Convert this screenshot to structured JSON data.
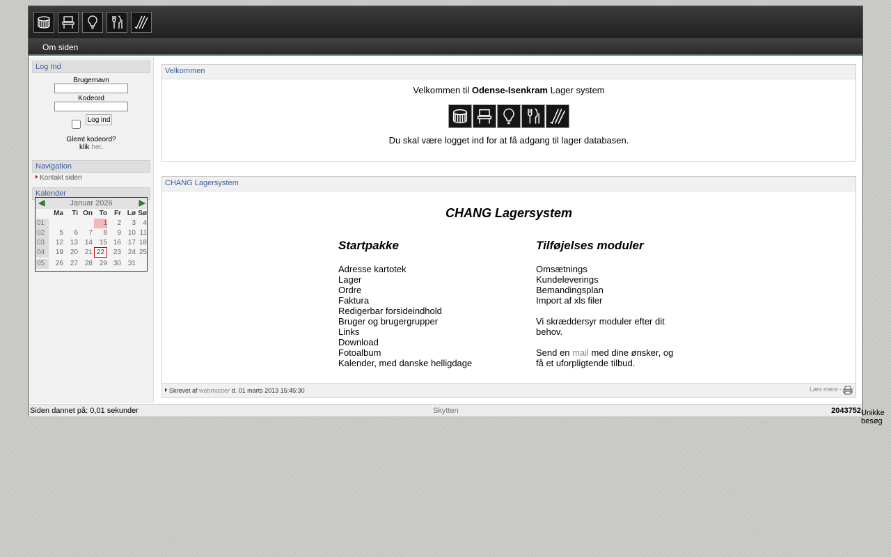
{
  "header": {
    "icons": [
      "drum-icon",
      "chair-icon",
      "lightbulb-icon",
      "dinnerware-icon",
      "tools-icon"
    ]
  },
  "topnav": {
    "om_siden": "Om siden"
  },
  "sidebar": {
    "login": {
      "title": "Log Ind",
      "username_label": "Brugernavn",
      "password_label": "Kodeord",
      "login_button": "Log ind",
      "forgot_line": "Glemt kodeord?",
      "click_text": "klik",
      "here_link": "her",
      "period": "."
    },
    "navigation": {
      "title": "Navigation",
      "items": [
        "Kontakt siden"
      ]
    },
    "calendar": {
      "title": "Kalender",
      "month_label": "Januar 2026",
      "weekdays": [
        "Ma",
        "Ti",
        "On",
        "To",
        "Fr",
        "Lø",
        "Sø"
      ],
      "weeks": [
        {
          "week": "01",
          "days": [
            "",
            "",
            "",
            "1",
            "2",
            "3",
            "4"
          ]
        },
        {
          "week": "02",
          "days": [
            "5",
            "6",
            "7",
            "8",
            "9",
            "10",
            "11"
          ]
        },
        {
          "week": "03",
          "days": [
            "12",
            "13",
            "14",
            "15",
            "16",
            "17",
            "18"
          ]
        },
        {
          "week": "04",
          "days": [
            "19",
            "20",
            "21",
            "22",
            "23",
            "24",
            "25"
          ]
        },
        {
          "week": "05",
          "days": [
            "26",
            "27",
            "28",
            "29",
            "30",
            "31",
            ""
          ]
        }
      ],
      "today": "22",
      "highlight": "1"
    }
  },
  "main": {
    "welcome": {
      "title": "Velkommen",
      "line_prefix": "Velkommen til",
      "line_bold": "Odense-Isenkram",
      "line_suffix": "Lager system",
      "note": "Du skal være logget ind for at få adgang til lager databasen."
    },
    "chang": {
      "title": "CHANG Lagersystem",
      "heading": "CHANG Lagersystem",
      "left_title": "Startpakke",
      "left_items": [
        "Adresse kartotek",
        "Lager",
        "Ordre",
        "Faktura",
        "Redigerbar forsideindhold",
        "Bruger og brugergrupper",
        "Links",
        "Download",
        "Fotoalbum",
        "Kalender, med danske helligdage"
      ],
      "right_title": "Tilføjelses moduler",
      "right_items": [
        "Omsætnings",
        "Kundeleverings",
        "Bemandingsplan",
        "Import af xls filer"
      ],
      "custom_line1": "Vi skræddersyr moduler efter dit",
      "custom_line2": "behov.",
      "send_prefix": "Send en",
      "send_link": "mail",
      "send_suffix": "med dine ønsker, og",
      "send_line2": "få et uforpligtende tilbud.",
      "footer_written": "Skrevet af",
      "footer_author": "webmaster",
      "footer_date": "d. 01 marts 2013 15:45:30",
      "read_more": "Læs mere",
      "read_more_sep": "-"
    }
  },
  "footer": {
    "generated": "Siden dannet på: 0,01 sekunder",
    "center": "Skytten",
    "visits_count": "2043752",
    "visits_label": "Unikke besøg"
  }
}
